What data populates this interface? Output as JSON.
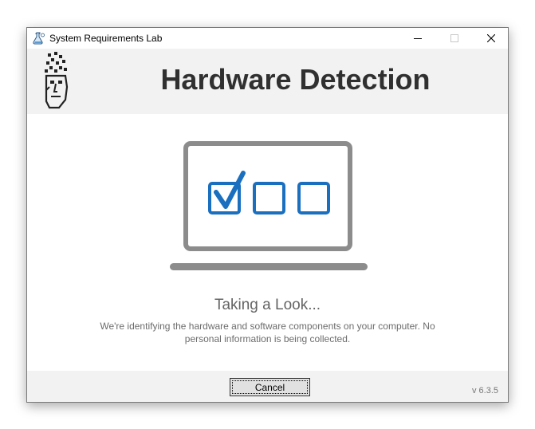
{
  "window": {
    "title": "System Requirements Lab",
    "icon": "flask-icon",
    "controls": {
      "minimize_icon": "minimize-icon",
      "maximize_icon": "maximize-icon",
      "close_icon": "close-icon"
    }
  },
  "header": {
    "logo": "srl-face-logo",
    "title": "Hardware Detection"
  },
  "illustration": {
    "icon": "laptop-checklist-icon",
    "checkboxes": [
      {
        "checked": true
      },
      {
        "checked": false
      },
      {
        "checked": false
      }
    ]
  },
  "status": {
    "title": "Taking a Look...",
    "description": "We're identifying the hardware and software components on your computer. No personal information is being collected."
  },
  "footer": {
    "cancel_label": "Cancel",
    "version": "v 6.3.5"
  },
  "colors": {
    "accent": "#1a6fbf",
    "laptop_gray": "#8c8c8c",
    "header_bg": "#f2f2f2",
    "title_text": "#303030"
  }
}
